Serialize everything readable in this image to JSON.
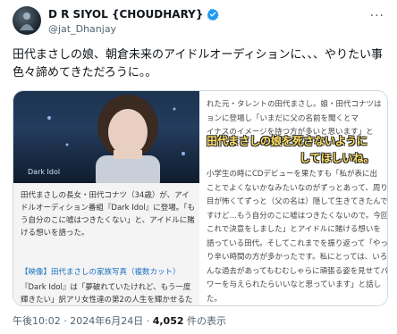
{
  "author": {
    "name": "D R SIYOL {CHOUDHARY}",
    "handle": "@jat_Dhanjay",
    "verified_icon": "verified-badge-icon"
  },
  "more_icon": "more-icon",
  "tweet": {
    "text": "田代まさしの娘、朝倉未来のアイドルオーディションに、、、やりたい事\n色々諦めてきただろうに。。"
  },
  "media": {
    "left": {
      "caption": "Dark Idol",
      "body": "田代まさしの長女・田代コナツ（34歳）が、アイドルオーディション番組『Dark Idol』に登場。「もう自分のこに嘘はつきたくない」と、アイドルに賭ける想いを語った。",
      "link": "【映像】田代まさしの家族写真（複数カット）",
      "body2": "『Dark Idol』は「夢破れていたけれど、もう一度輝きたい」訳アリ女性達の第2の人生を輝かせるため"
    },
    "right": {
      "lines_top": [
        "れた元・タレントの田代まさし。娘・田代コナツは",
        "ョンに登場し「いまだに父の名前を聞くとマ",
        "イナスのイメージを持つ方が多いと思います」と"
      ],
      "highlight1": "田代まさしの娘を死さないように",
      "highlight2": "してほしいね。",
      "lines_bottom": [
        "小学生の時にCDデビューを果たすも「私が表に出",
        "ことでよくないかなみたいなのがずっとあって、周りの",
        "目が怖くてずっと（父の名は）隠して生きてきたんです",
        "すけど…もう自分のこに嘘はつきたくないので。今回",
        "これで決意をしました」とアイドルに賭ける想いを",
        "語っている田代。そしてこれまでを振り返って「やっぱ",
        "り辛い時間の方が多かったです。私にとっては、いろ",
        "んな過去があってもむむしゃらに頑張る姿を見せてパ",
        "ワーを与えられたらいいなと思っています」と話し",
        "た。"
      ]
    }
  },
  "meta": {
    "time": "午後10:02",
    "separator": " · ",
    "date": "2024年6月24日",
    "views_count": "4,052",
    "views_label": " 件の表示"
  }
}
